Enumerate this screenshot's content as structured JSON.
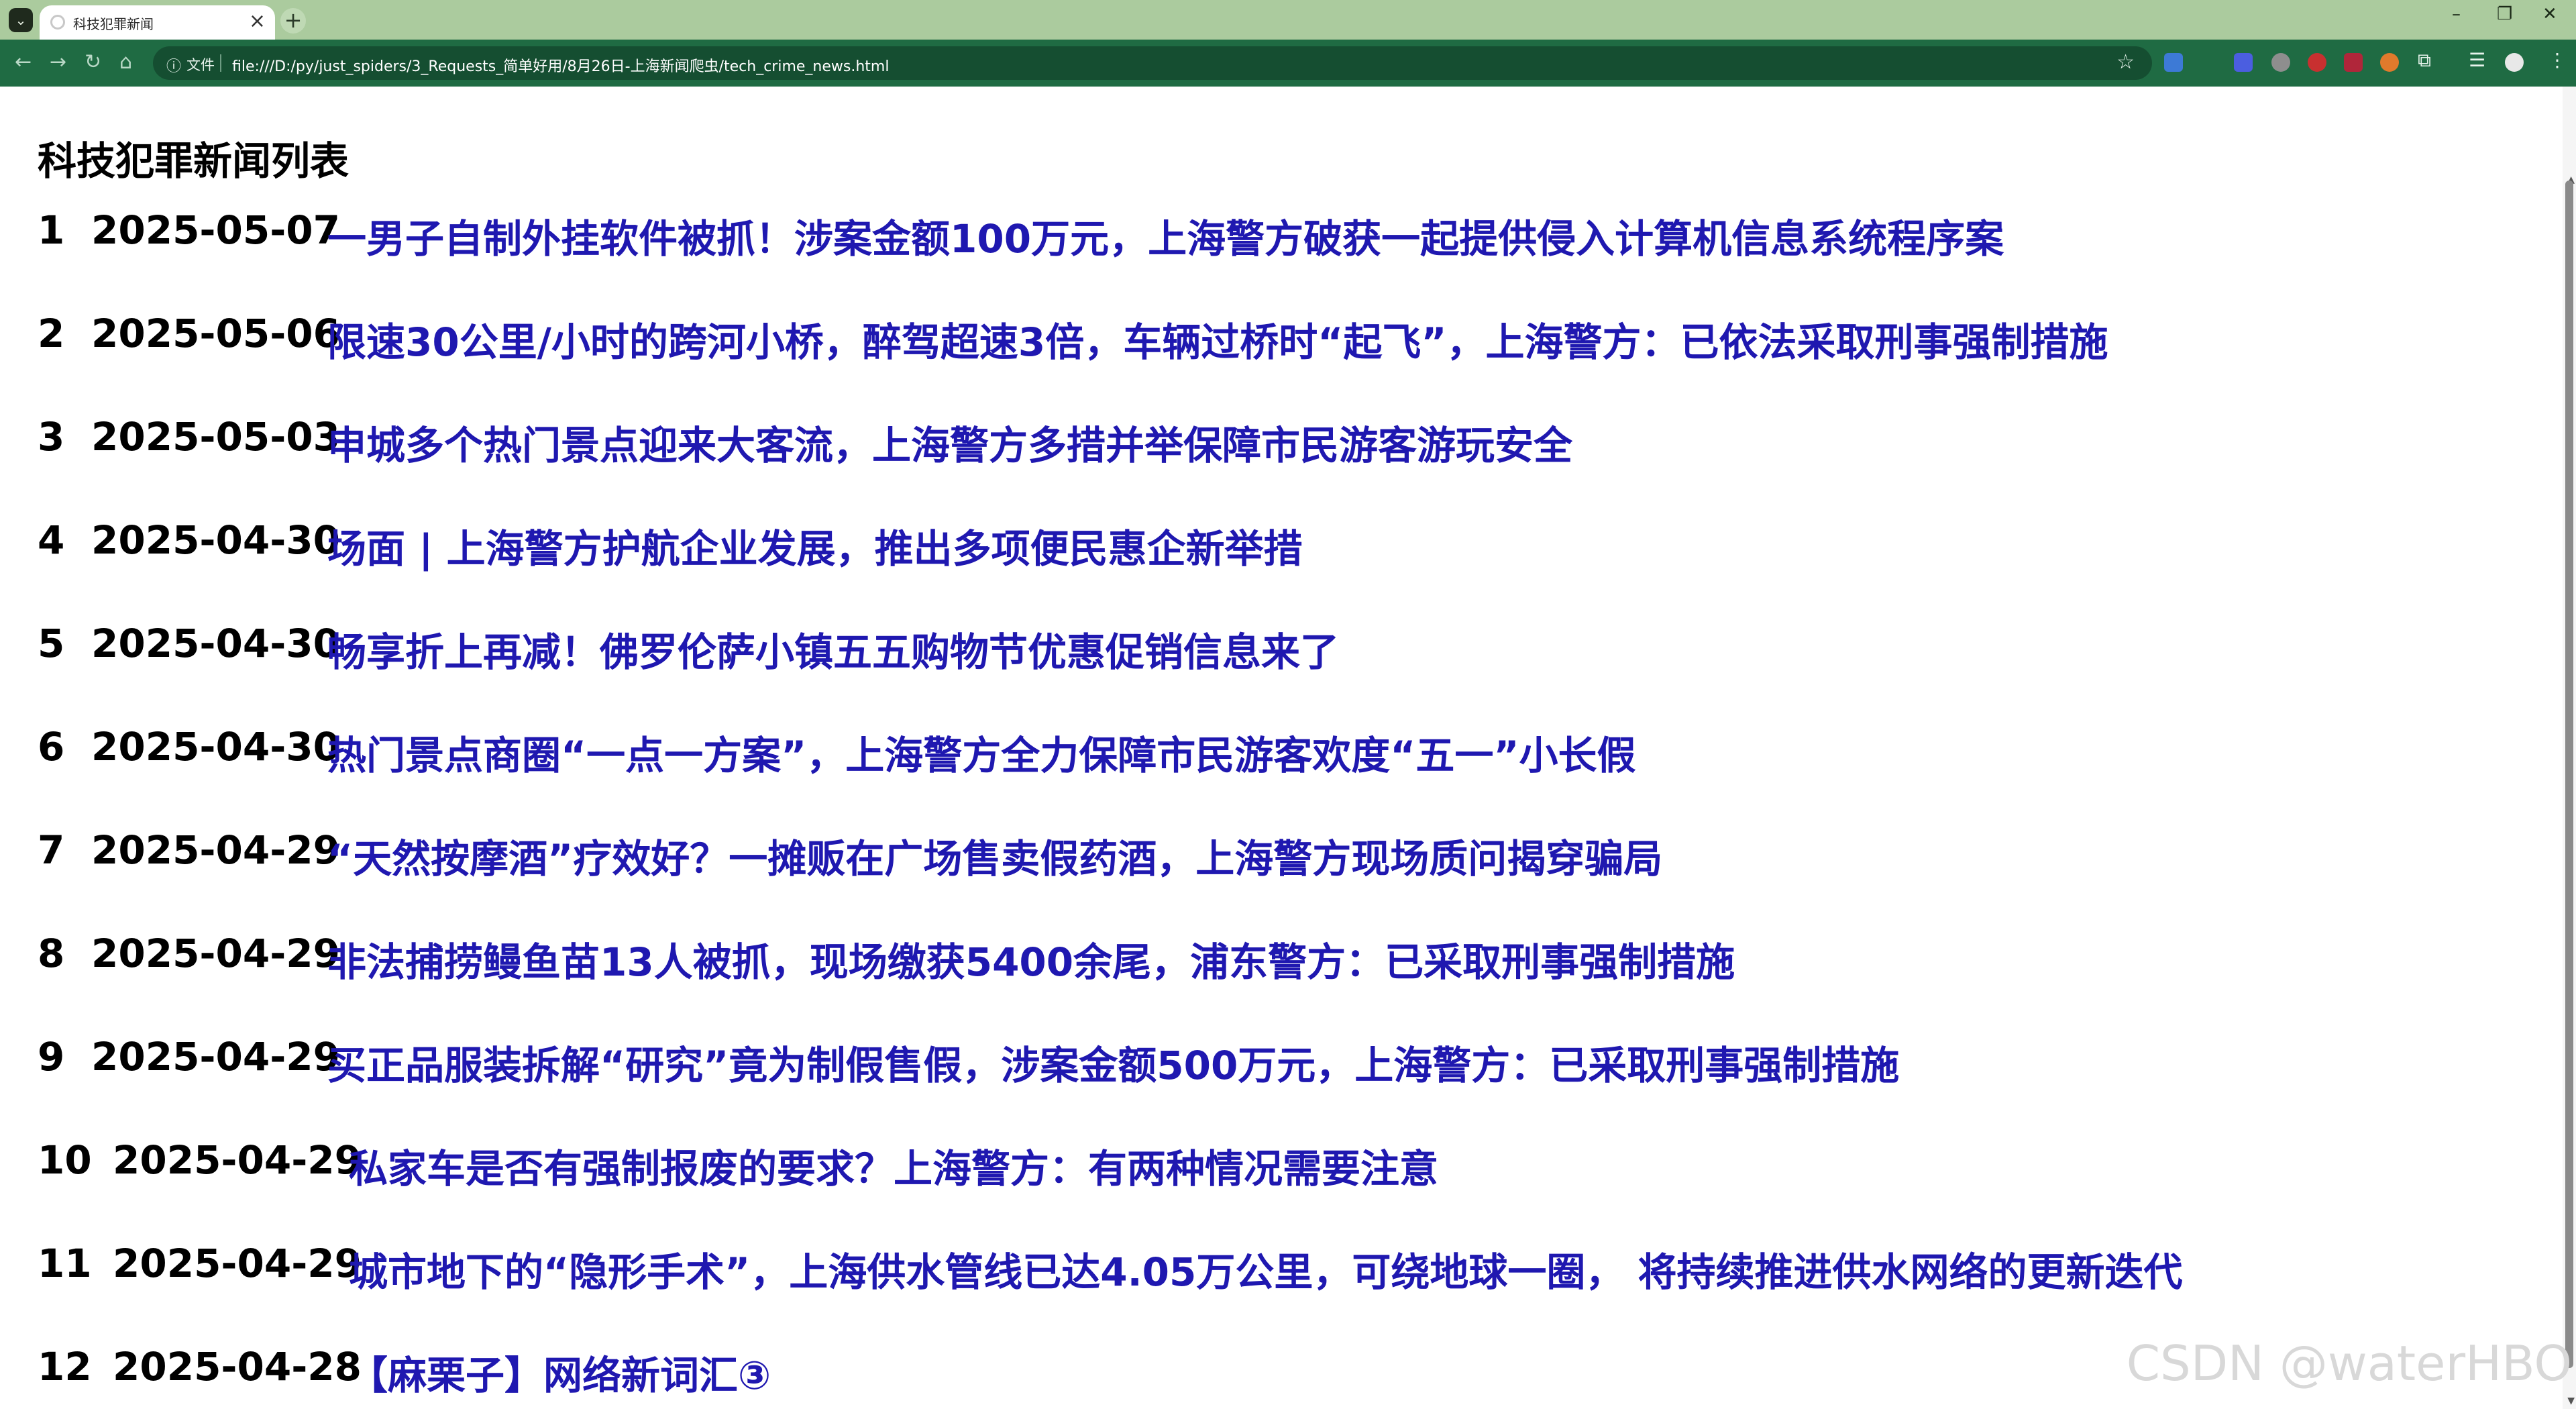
{
  "browser": {
    "tab_title": "科技犯罪新闻",
    "new_tab": "+",
    "tab_close": "×",
    "file_label": "文件",
    "url": "file:///D:/py/just_spiders/3_Requests_简单好用/8月26日-上海新闻爬虫/tech_crime_news.html"
  },
  "page": {
    "title": "科技犯罪新闻列表"
  },
  "news": [
    {
      "num": "1",
      "date": "2025-05-07",
      "title": "一男子自制外挂软件被抓！涉案金额100万元，上海警方破获一起提供侵入计算机信息系统程序案"
    },
    {
      "num": "2",
      "date": "2025-05-06",
      "title": "限速30公里/小时的跨河小桥，醉驾超速3倍，车辆过桥时“起飞”，上海警方：已依法采取刑事强制措施"
    },
    {
      "num": "3",
      "date": "2025-05-03",
      "title": "申城多个热门景点迎来大客流，上海警方多措并举保障市民游客游玩安全"
    },
    {
      "num": "4",
      "date": "2025-04-30",
      "title": "场面 | 上海警方护航企业发展，推出多项便民惠企新举措"
    },
    {
      "num": "5",
      "date": "2025-04-30",
      "title": "畅享折上再减！佛罗伦萨小镇五五购物节优惠促销信息来了"
    },
    {
      "num": "6",
      "date": "2025-04-30",
      "title": "热门景点商圈“一点一方案”，上海警方全力保障市民游客欢度“五一”小长假"
    },
    {
      "num": "7",
      "date": "2025-04-29",
      "title": "“天然按摩酒”疗效好？一摊贩在广场售卖假药酒，上海警方现场质问揭穿骗局"
    },
    {
      "num": "8",
      "date": "2025-04-29",
      "title": "非法捕捞鳗鱼苗13人被抓，现场缴获5400余尾，浦东警方：已采取刑事强制措施"
    },
    {
      "num": "9",
      "date": "2025-04-29",
      "title": "买正品服装拆解“研究”竟为制假售假，涉案金额500万元，上海警方：已采取刑事强制措施"
    },
    {
      "num": "10",
      "date": "2025-04-29",
      "title": "私家车是否有强制报废的要求？上海警方：有两种情况需要注意"
    },
    {
      "num": "11",
      "date": "2025-04-29",
      "title": "城市地下的“隐形手术”，上海供水管线已达4.05万公里，可绕地球一圈， 将持续推进供水网络的更新迭代"
    },
    {
      "num": "12",
      "date": "2025-04-28",
      "title": "【麻栗子】网络新词汇③"
    }
  ],
  "watermark": "CSDN @waterHBO",
  "colors": {
    "tab_strip": "#abcb9e",
    "toolbar": "#1f6b43",
    "link": "#1f18b0"
  }
}
